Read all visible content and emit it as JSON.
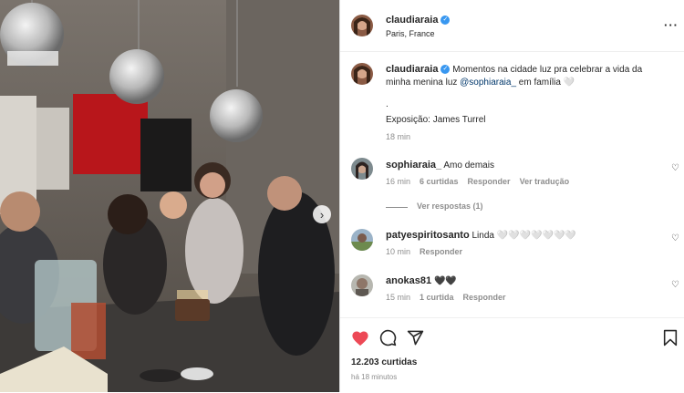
{
  "post": {
    "username": "claudiaraia",
    "location": "Paris, France",
    "caption_user": "claudiaraia",
    "caption_line1": "Momentos na cidade luz pra celebrar a vida da",
    "caption_line2_pre": "minha menina luz",
    "caption_mention": "@sophiaraia_",
    "caption_line2_post": "em família 🤍",
    "caption_dot": ".",
    "caption_exhibit": "Exposição: James Turrel",
    "caption_time": "18 min"
  },
  "comments": [
    {
      "user": "sophiaraia_",
      "text": "Amo demais",
      "time": "16 min",
      "likes": "6 curtidas",
      "reply": "Responder",
      "translate": "Ver tradução",
      "view_replies": "Ver respostas (1)"
    },
    {
      "user": "patyespiritosanto",
      "text": "Linda 🤍🤍🤍🤍🤍🤍🤍",
      "time": "10 min",
      "reply": "Responder"
    },
    {
      "user": "anokas81",
      "text": "🖤🖤",
      "time": "15 min",
      "likes": "1 curtida",
      "reply": "Responder"
    }
  ],
  "footer": {
    "likes": "12.203 curtidas",
    "posted": "há 18 minutos"
  },
  "colors": {
    "liked_heart": "#ed4956",
    "verified": "#3897f0",
    "link": "#00376b"
  },
  "icons": [
    "heart-icon",
    "comment-icon",
    "share-icon",
    "bookmark-icon",
    "more-icon",
    "chevron-right-icon",
    "verified-icon"
  ]
}
